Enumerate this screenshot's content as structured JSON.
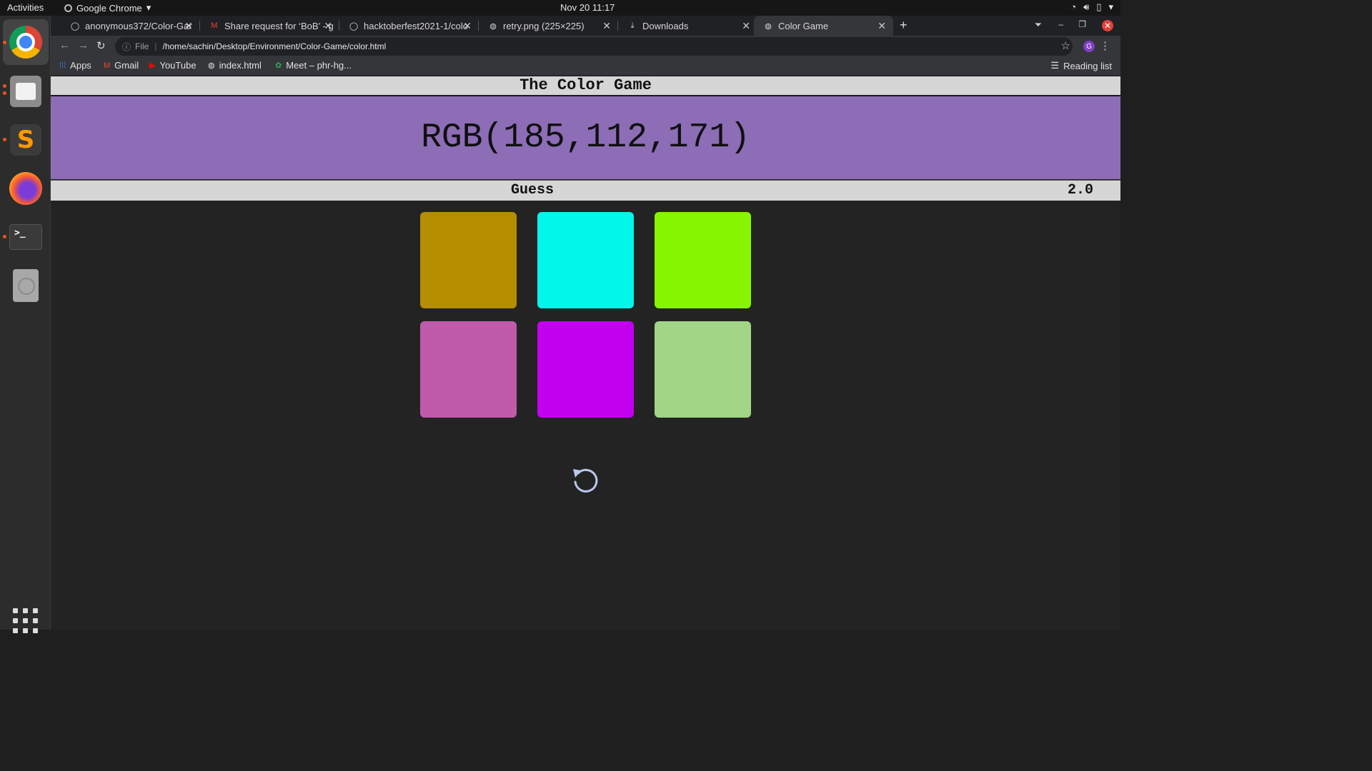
{
  "system": {
    "activities": "Activities",
    "app_menu": "Google Chrome",
    "clock": "Nov 20  11:17"
  },
  "tabs": [
    {
      "title": "anonymous372/Color-Gar",
      "icon": "github-icon",
      "active": false
    },
    {
      "title": "Share request for ‘BoB’ - g",
      "icon": "gmail-icon",
      "active": false
    },
    {
      "title": "hacktoberfest2021-1/colo",
      "icon": "github-icon",
      "active": false
    },
    {
      "title": "retry.png (225×225)",
      "icon": "globe-icon",
      "active": false
    },
    {
      "title": "Downloads",
      "icon": "download-icon",
      "active": false
    },
    {
      "title": "Color Game",
      "icon": "globe-icon",
      "active": true
    }
  ],
  "omnibox": {
    "scheme_label": "File",
    "url": "/home/sachin/Desktop/Environment/Color-Game/color.html"
  },
  "profile_initial": "G",
  "bookmarks": [
    {
      "label": "Apps",
      "icon": "apps-grid-icon"
    },
    {
      "label": "Gmail",
      "icon": "gmail-icon"
    },
    {
      "label": "YouTube",
      "icon": "youtube-icon"
    },
    {
      "label": "index.html",
      "icon": "globe-icon"
    },
    {
      "label": "Meet – phr-hg...",
      "icon": "meet-icon"
    }
  ],
  "reading_list": "Reading list",
  "game": {
    "title": "The Color Game",
    "target_color": "RGB(185,112,171)",
    "banner_color": "#8c6db6",
    "message": "Guess",
    "score": "2.0",
    "squares": [
      {
        "color": "#b58e00"
      },
      {
        "color": "#00f7e9"
      },
      {
        "color": "#86f500"
      },
      {
        "color": "#c05aab"
      },
      {
        "color": "#c300f0"
      },
      {
        "color": "#a2d586"
      }
    ]
  }
}
